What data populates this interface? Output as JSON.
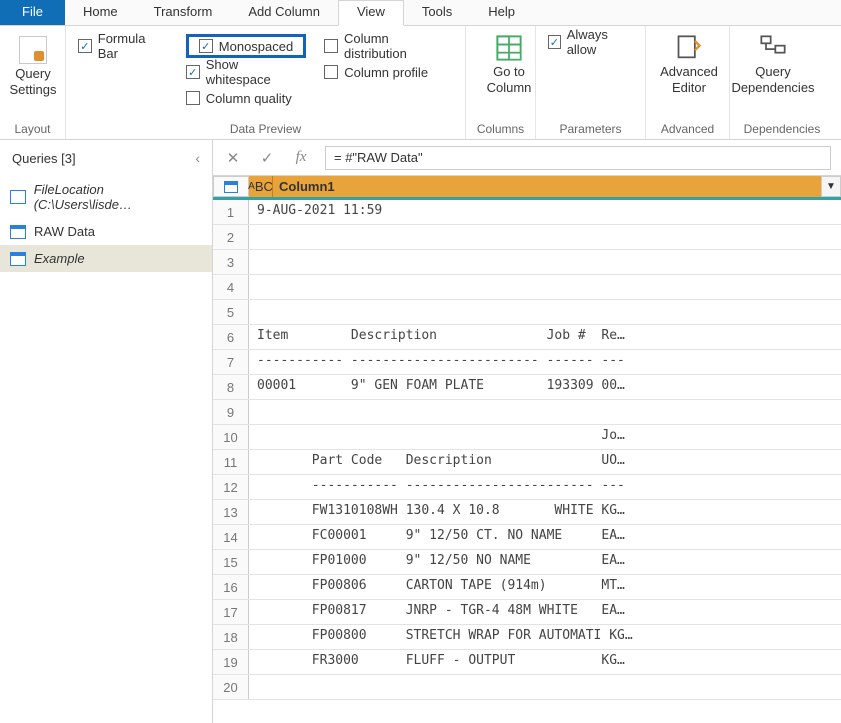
{
  "menu": {
    "file": "File",
    "home": "Home",
    "transform": "Transform",
    "addcol": "Add Column",
    "view": "View",
    "tools": "Tools",
    "help": "Help"
  },
  "ribbon": {
    "qs": "Query\nSettings",
    "layout": "Layout",
    "formula": "Formula Bar",
    "mono": "Monospaced",
    "showws": "Show whitespace",
    "colqual": "Column quality",
    "coldist": "Column distribution",
    "colprof": "Column profile",
    "datapreview": "Data Preview",
    "gotocol": "Go to\nColumn",
    "columns": "Columns",
    "always": "Always allow",
    "params": "Parameters",
    "adv": "Advanced\nEditor",
    "advlabel": "Advanced",
    "dep": "Query\nDependencies",
    "deplabel": "Dependencies"
  },
  "queries": {
    "title": "Queries [3]",
    "items": [
      "FileLocation (C:\\Users\\lisde…",
      "RAW Data",
      "Example"
    ]
  },
  "fx": {
    "formula": "= #\"RAW Data\""
  },
  "column": {
    "name": "Column1",
    "type": "A B C"
  },
  "rows": [
    "9-AUG-2021 11:59",
    "",
    "",
    "",
    "",
    "Item        Description              Job #  Re…",
    "----------- ------------------------ ------ ---",
    "00001       9\" GEN FOAM PLATE        193309 00…",
    "",
    "                                            Jo…",
    "       Part Code   Description              UO…",
    "       ----------- ------------------------ ---",
    "       FW1310108WH 130.4 X 10.8       WHITE KG…",
    "       FC00001     9\" 12/50 CT. NO NAME     EA…",
    "       FP01000     9\" 12/50 NO NAME         EA…",
    "       FP00806     CARTON TAPE (914m)       MT…",
    "       FP00817     JNRP - TGR-4 48M WHITE   EA…",
    "       FP00800     STRETCH WRAP FOR AUTOMATI KG…",
    "       FR3000      FLUFF - OUTPUT           KG…",
    ""
  ],
  "chart_data": null
}
